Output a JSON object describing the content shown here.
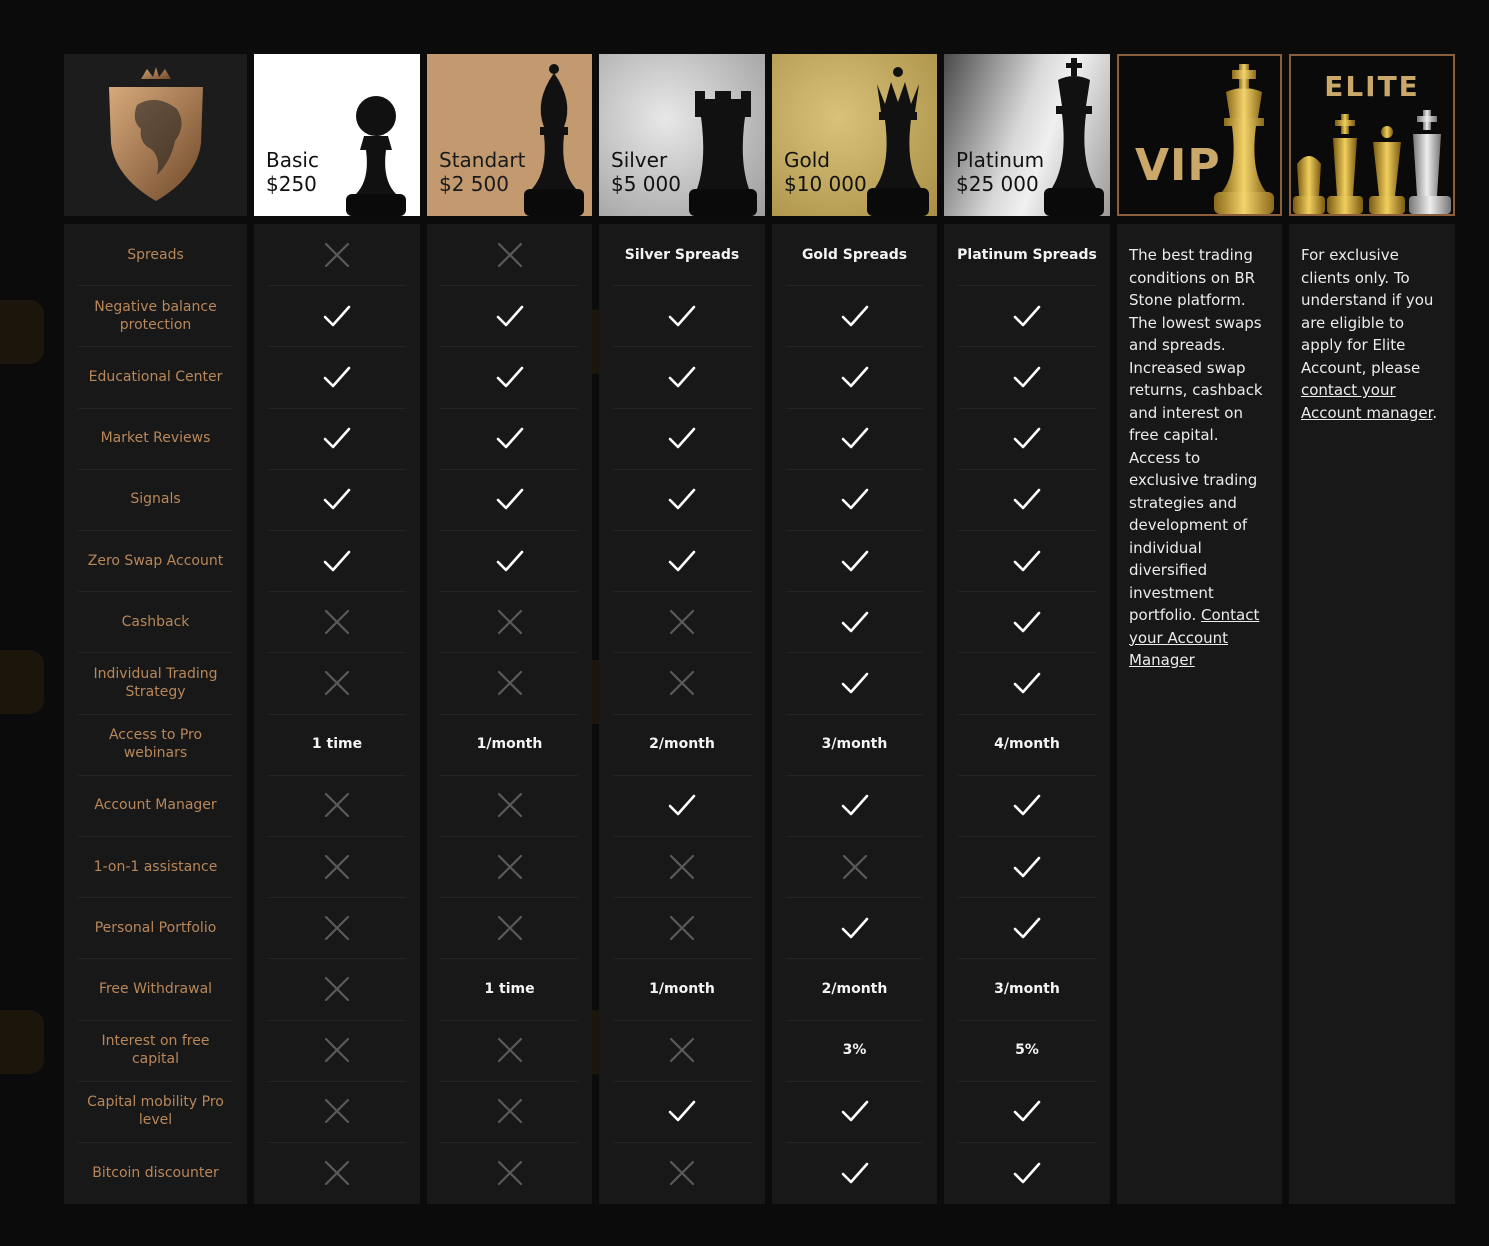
{
  "brand": {
    "logo_icon": "lion-shield-icon",
    "accent": "#b8875a",
    "border": "#8b5e3c"
  },
  "tiers": [
    {
      "name": "Basic",
      "price": "$250",
      "icon": "pawn-icon"
    },
    {
      "name": "Standart",
      "price": "$2 500",
      "icon": "bishop-icon"
    },
    {
      "name": "Silver",
      "price": "$5 000",
      "icon": "rook-icon"
    },
    {
      "name": "Gold",
      "price": "$10 000",
      "icon": "queen-icon"
    },
    {
      "name": "Platinum",
      "price": "$25 000",
      "icon": "king-icon"
    },
    {
      "name": "VIP",
      "icon": "gold-king-icon"
    },
    {
      "name": "ELITE",
      "icon": "chess-pieces-icon"
    }
  ],
  "features": [
    {
      "label": "Spreads",
      "values": [
        "x",
        "x",
        "Silver Spreads",
        "Gold Spreads",
        "Platinum Spreads"
      ]
    },
    {
      "label": "Negative balance protection",
      "values": [
        "check",
        "check",
        "check",
        "check",
        "check"
      ]
    },
    {
      "label": "Educational Center",
      "values": [
        "check",
        "check",
        "check",
        "check",
        "check"
      ]
    },
    {
      "label": "Market Reviews",
      "values": [
        "check",
        "check",
        "check",
        "check",
        "check"
      ]
    },
    {
      "label": "Signals",
      "values": [
        "check",
        "check",
        "check",
        "check",
        "check"
      ]
    },
    {
      "label": "Zero Swap Account",
      "values": [
        "check",
        "check",
        "check",
        "check",
        "check"
      ]
    },
    {
      "label": "Cashback",
      "values": [
        "x",
        "x",
        "x",
        "check",
        "check"
      ]
    },
    {
      "label": "Individual Trading Strategy",
      "values": [
        "x",
        "x",
        "x",
        "check",
        "check"
      ]
    },
    {
      "label": "Access to Pro webinars",
      "values": [
        "1 time",
        "1/month",
        "2/month",
        "3/month",
        "4/month"
      ]
    },
    {
      "label": "Account Manager",
      "values": [
        "x",
        "x",
        "check",
        "check",
        "check"
      ]
    },
    {
      "label": "1-on-1 assistance",
      "values": [
        "x",
        "x",
        "x",
        "x",
        "check"
      ]
    },
    {
      "label": "Personal Portfolio",
      "values": [
        "x",
        "x",
        "x",
        "check",
        "check"
      ]
    },
    {
      "label": "Free Withdrawal",
      "values": [
        "x",
        "1 time",
        "1/month",
        "2/month",
        "3/month"
      ]
    },
    {
      "label": "Interest on free capital",
      "values": [
        "x",
        "x",
        "x",
        "3%",
        "5%"
      ]
    },
    {
      "label": "Capital mobility Pro level",
      "values": [
        "x",
        "x",
        "check",
        "check",
        "check"
      ]
    },
    {
      "label": "Bitcoin discounter",
      "values": [
        "x",
        "x",
        "x",
        "check",
        "check"
      ]
    }
  ],
  "vip_description": {
    "text": "The best trading conditions on BR Stone platform. The lowest swaps and spreads. Increased swap returns, cashback and interest on free capital. Access to exclusive trading strategies and development of individual diversified investment portfolio. ",
    "link": "Contact your Account Manager"
  },
  "elite_description": {
    "text": "For exclusive clients only. To understand if you are eligible to apply for Elite Account, please ",
    "link": "contact your Account manager",
    "suffix": "."
  }
}
